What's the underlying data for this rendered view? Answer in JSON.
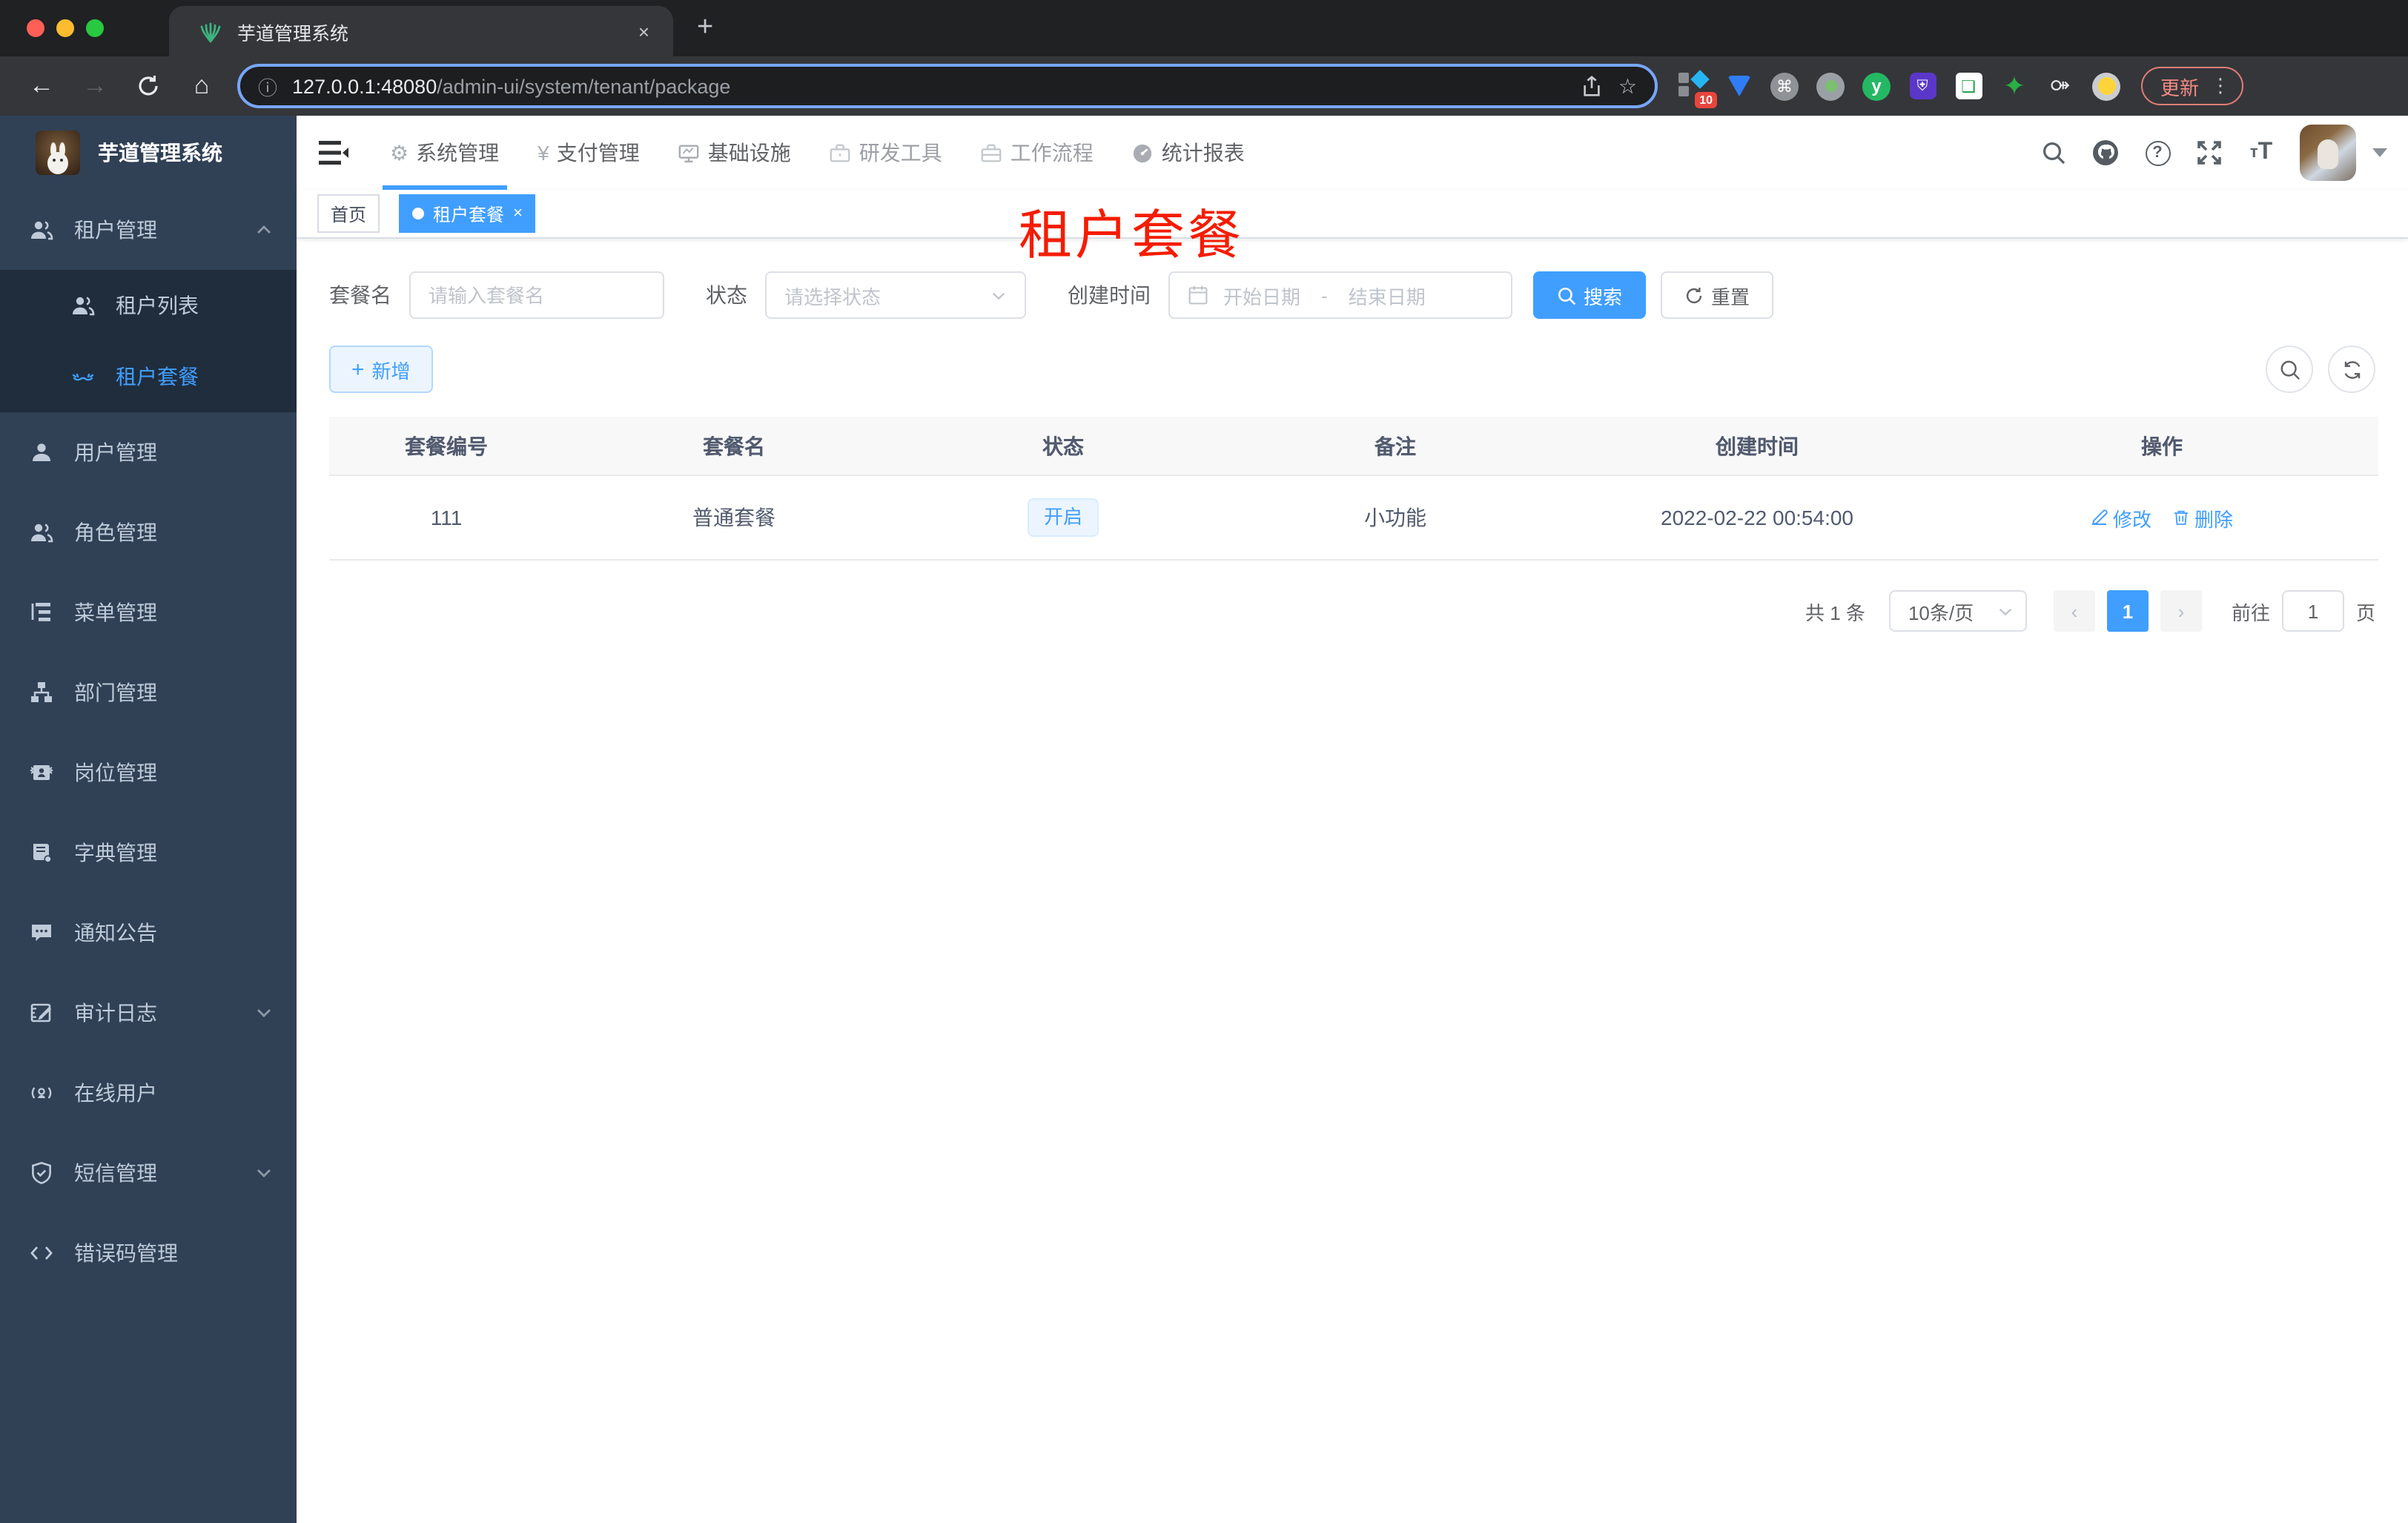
{
  "browser": {
    "tab_title": "芋道管理系统",
    "tab_close": "×",
    "new_tab": "+",
    "url_host": "127.0.0.1:48080",
    "url_path": "/admin-ui/system/tenant/package",
    "update_label": "更新",
    "kebab": "⋮",
    "extension_badge": "10"
  },
  "sidebar": {
    "logo_title": "芋道管理系统",
    "items": [
      {
        "label": "租户管理"
      },
      {
        "label": "租户列表"
      },
      {
        "label": "租户套餐"
      },
      {
        "label": "用户管理"
      },
      {
        "label": "角色管理"
      },
      {
        "label": "菜单管理"
      },
      {
        "label": "部门管理"
      },
      {
        "label": "岗位管理"
      },
      {
        "label": "字典管理"
      },
      {
        "label": "通知公告"
      },
      {
        "label": "审计日志"
      },
      {
        "label": "在线用户"
      },
      {
        "label": "短信管理"
      },
      {
        "label": "错误码管理"
      }
    ]
  },
  "nav": {
    "items": [
      {
        "label": "系统管理"
      },
      {
        "label": "支付管理"
      },
      {
        "label": "基础设施"
      },
      {
        "label": "研发工具"
      },
      {
        "label": "工作流程"
      },
      {
        "label": "统计报表"
      }
    ],
    "yen": "¥",
    "gear": "⚙"
  },
  "tags": {
    "home": "首页",
    "active": "租户套餐",
    "close": "×"
  },
  "page_title": "租户套餐",
  "filters": {
    "name_label": "套餐名",
    "name_placeholder": "请输入套餐名",
    "status_label": "状态",
    "status_placeholder": "请选择状态",
    "date_label": "创建时间",
    "date_start": "开始日期",
    "date_sep": "-",
    "date_end": "结束日期",
    "search_label": "搜索",
    "reset_label": "重置",
    "add_label": "新增",
    "plus": "+"
  },
  "table": {
    "columns": [
      "套餐编号",
      "套餐名",
      "状态",
      "备注",
      "创建时间",
      "操作"
    ],
    "rows": [
      {
        "id": "111",
        "name": "普通套餐",
        "status": "开启",
        "remark": "小功能",
        "created_at": "2022-02-22 00:54:00",
        "edit": "修改",
        "delete": "删除"
      }
    ]
  },
  "pagination": {
    "total": "共 1 条",
    "page_size": "10条/页",
    "prev": "‹",
    "current": "1",
    "next": "›",
    "goto_label": "前往",
    "goto_value": "1",
    "unit": "页"
  },
  "colors": {
    "primary": "#409eff",
    "sidebar_bg": "#304156",
    "submenu_bg": "#1f2d3d",
    "title_red": "#f51c00",
    "tag_active_bg": "#409eff"
  }
}
